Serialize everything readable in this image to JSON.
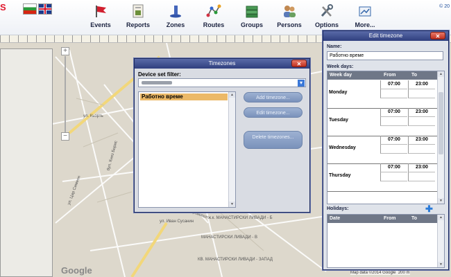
{
  "app": {
    "logo": "S",
    "copyright": "© 20"
  },
  "languages": [
    {
      "name": "bg-flag-icon"
    },
    {
      "name": "uk-flag-icon"
    }
  ],
  "nav": [
    {
      "label": "Events",
      "icon": "flag-icon",
      "color": "#cc2233"
    },
    {
      "label": "Reports",
      "icon": "report-icon",
      "color": "#6b8f3a"
    },
    {
      "label": "Zones",
      "icon": "zone-icon",
      "color": "#3355aa"
    },
    {
      "label": "Routes",
      "icon": "route-icon",
      "color": "#cc3344"
    },
    {
      "label": "Groups",
      "icon": "groups-icon",
      "color": "#4a9a55"
    },
    {
      "label": "Persons",
      "icon": "persons-icon",
      "color": "#aa7733"
    },
    {
      "label": "Options",
      "icon": "tools-icon",
      "color": "#556677"
    },
    {
      "label": "More...",
      "icon": "more-icon",
      "color": "#3366aa"
    }
  ],
  "map": {
    "attribution": "Map data ©2014 Google",
    "scale": "200 m",
    "watermark": "Google",
    "labels": [
      "ул. Кьорть",
      "бул. Княз Борис",
      "ул. Цар Симеон",
      "ж.к. МАНАСТИРСКИ ЛИВАДИ - Б",
      "КВ. МАНАСТИРСКИ ЛИВАДИ - ЗАПАД",
      "МАНАСТИРСКИ ЛИВАДИ - В",
      "ул. Иван Сусанин",
      "бул. Бълг. Промишл"
    ]
  },
  "timezones_dialog": {
    "title": "Timezones",
    "filter_label": "Device set filter:",
    "items": [
      "Работно време"
    ],
    "buttons": {
      "add": "Add timezone...",
      "edit": "Edit timezone...",
      "delete": "Delete timezones..."
    }
  },
  "edit_dialog": {
    "title": "Edit timezone",
    "name_label": "Name:",
    "name_value": "Работно време",
    "week_days_label": "Week days:",
    "columns": [
      "Week day",
      "From",
      "To"
    ],
    "days": [
      {
        "day": "Monday",
        "from": "07:00",
        "to": "23:00"
      },
      {
        "day": "Tuesday",
        "from": "07:00",
        "to": "23:00"
      },
      {
        "day": "Wednesday",
        "from": "07:00",
        "to": "23:00"
      },
      {
        "day": "Thursday",
        "from": "07:00",
        "to": "23:00"
      }
    ],
    "holidays_label": "Holidays:",
    "holiday_columns": [
      "Date",
      "From",
      "To"
    ]
  }
}
